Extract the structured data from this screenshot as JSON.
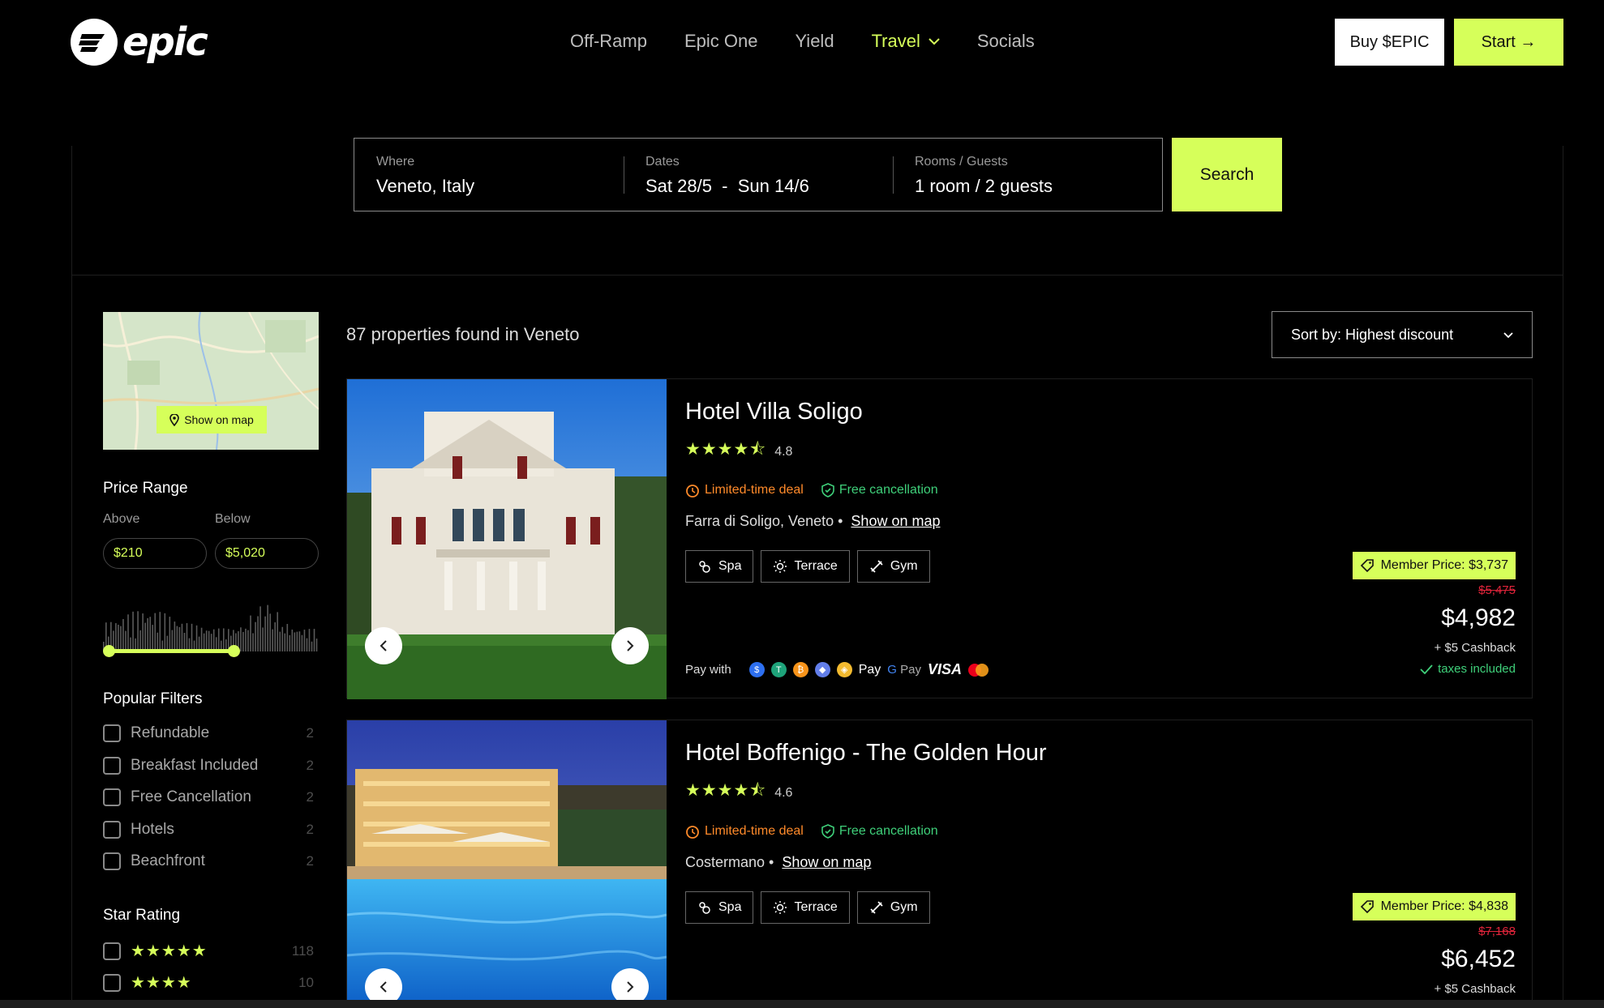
{
  "header": {
    "logo_text": "epic",
    "nav": [
      {
        "label": "Off-Ramp"
      },
      {
        "label": "Epic One"
      },
      {
        "label": "Yield"
      },
      {
        "label": "Travel",
        "active": true,
        "dropdown": true
      },
      {
        "label": "Socials"
      }
    ],
    "buy_label": "Buy $EPIC",
    "start_label": "Start →"
  },
  "search": {
    "where_label": "Where",
    "where_value": "Veneto, Italy",
    "dates_label": "Dates",
    "dates_value": "Sat 28/5  -  Sun 14/6",
    "guests_label": "Rooms / Guests",
    "guests_value": "1 room / 2 guests",
    "button_label": "Search"
  },
  "sidebar": {
    "map_button": "Show on map",
    "price_range_title": "Price Range",
    "above_label": "Above",
    "below_label": "Below",
    "above_value": "$210",
    "below_value": "$5,020",
    "popular_title": "Popular Filters",
    "filters": [
      {
        "label": "Refundable",
        "count": "2"
      },
      {
        "label": "Breakfast Included",
        "count": "2"
      },
      {
        "label": "Free Cancellation",
        "count": "2"
      },
      {
        "label": "Hotels",
        "count": "2"
      },
      {
        "label": "Beachfront",
        "count": "2"
      }
    ],
    "star_title": "Star Rating",
    "star_filters": [
      {
        "stars": "★★★★★",
        "count": "118"
      },
      {
        "stars": "★★★★",
        "count": "10"
      }
    ]
  },
  "results": {
    "count_text": "87 properties found in Veneto",
    "sort_label": "Sort by: Highest discount"
  },
  "hotels": [
    {
      "name": "Hotel Villa Soligo",
      "rating": "4.8",
      "deal": "Limited-time deal",
      "free_cancel": "Free cancellation",
      "location": "Farra di Soligo, Veneto  •",
      "map_link": "Show on map",
      "amenities": [
        "Spa",
        "Terrace",
        "Gym"
      ],
      "pay_with": "Pay with",
      "apple_pay": "Pay",
      "google_pay": "Pay",
      "visa": "VISA",
      "member_price": "Member Price: $3,737",
      "old_price": "$5,475",
      "price": "$4,982",
      "cashback": "+ $5 Cashback",
      "taxes": "taxes included"
    },
    {
      "name": "Hotel Boffenigo - The Golden Hour",
      "rating": "4.6",
      "deal": "Limited-time deal",
      "free_cancel": "Free cancellation",
      "location": "Costermano •",
      "map_link": "Show on map",
      "amenities": [
        "Spa",
        "Terrace",
        "Gym"
      ],
      "member_price": "Member Price: $4,838",
      "old_price": "$7,168",
      "price": "$6,452",
      "cashback": "+ $5 Cashback"
    }
  ],
  "colors": {
    "accent": "#d6ff5a",
    "deal": "#ff8a2a",
    "success": "#3fd07a",
    "strike": "#e0243a"
  }
}
